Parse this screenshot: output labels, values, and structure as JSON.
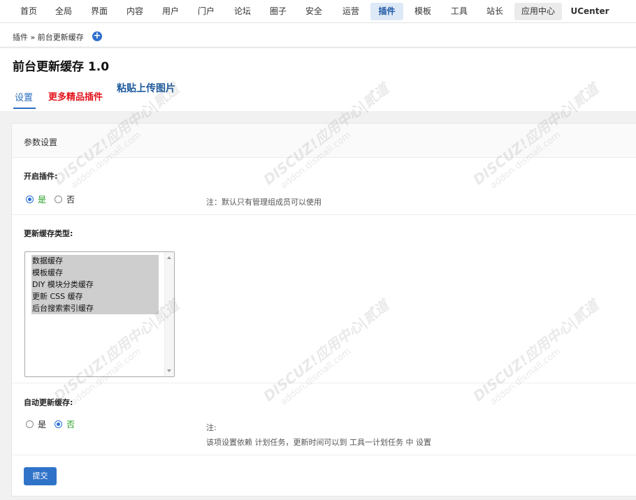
{
  "topnav": {
    "items": [
      "首页",
      "全局",
      "界面",
      "内容",
      "用户",
      "门户",
      "论坛",
      "圈子",
      "安全",
      "运营",
      "插件",
      "模板",
      "工具",
      "站长",
      "应用中心",
      "UCenter"
    ],
    "active": "插件"
  },
  "breadcrumb": {
    "text": "插件 » 前台更新缓存",
    "add_icon": "plus-circle-icon"
  },
  "page": {
    "title": "前台更新缓存 1.0",
    "tabs": {
      "settings": "设置",
      "more_plugins": "更多精品插件",
      "paste_upload": "粘贴上传图片"
    }
  },
  "panel": {
    "heading": "参数设置",
    "enable": {
      "label": "开启插件:",
      "options": [
        "是",
        "否"
      ],
      "selected": "是",
      "note": "注：默认只有管理组成员可以使用"
    },
    "cache_types": {
      "label": "更新缓存类型:",
      "options": [
        "数据缓存",
        "模板缓存",
        "DIY 模块分类缓存",
        "更新 CSS 缓存",
        "后台搜索索引缓存"
      ]
    },
    "auto_update": {
      "label": "自动更新缓存:",
      "options": [
        "是",
        "否"
      ],
      "selected": "否",
      "note_line1": "注:",
      "note_line2": "该项设置依赖 计划任务，更新时间可以到 工具一计划任务 中 设置"
    },
    "submit_label": "提交"
  },
  "watermark": {
    "text_main": "DISCUZ!应用中心|贰道",
    "text_sub": "addon.dismall.com"
  },
  "colors": {
    "accent": "#2f73c9",
    "active_tab_bg": "#dde9f7",
    "red_link": "#e3141c",
    "selected_radio_text": "#1f9c1f"
  }
}
